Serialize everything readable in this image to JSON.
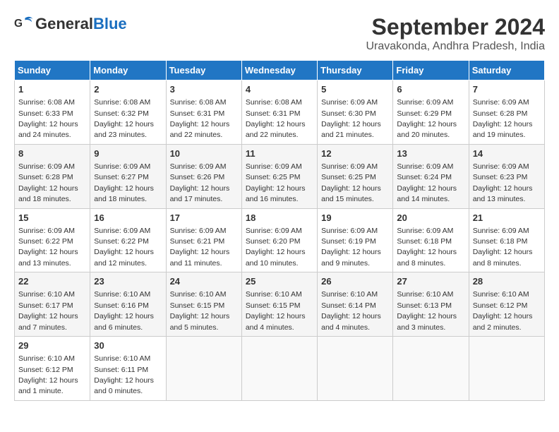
{
  "header": {
    "logo_general": "General",
    "logo_blue": "Blue",
    "title": "September 2024",
    "subtitle": "Uravakonda, Andhra Pradesh, India"
  },
  "columns": [
    "Sunday",
    "Monday",
    "Tuesday",
    "Wednesday",
    "Thursday",
    "Friday",
    "Saturday"
  ],
  "weeks": [
    [
      {
        "day": "1",
        "sunrise": "Sunrise: 6:08 AM",
        "sunset": "Sunset: 6:33 PM",
        "daylight": "Daylight: 12 hours and 24 minutes."
      },
      {
        "day": "2",
        "sunrise": "Sunrise: 6:08 AM",
        "sunset": "Sunset: 6:32 PM",
        "daylight": "Daylight: 12 hours and 23 minutes."
      },
      {
        "day": "3",
        "sunrise": "Sunrise: 6:08 AM",
        "sunset": "Sunset: 6:31 PM",
        "daylight": "Daylight: 12 hours and 22 minutes."
      },
      {
        "day": "4",
        "sunrise": "Sunrise: 6:08 AM",
        "sunset": "Sunset: 6:31 PM",
        "daylight": "Daylight: 12 hours and 22 minutes."
      },
      {
        "day": "5",
        "sunrise": "Sunrise: 6:09 AM",
        "sunset": "Sunset: 6:30 PM",
        "daylight": "Daylight: 12 hours and 21 minutes."
      },
      {
        "day": "6",
        "sunrise": "Sunrise: 6:09 AM",
        "sunset": "Sunset: 6:29 PM",
        "daylight": "Daylight: 12 hours and 20 minutes."
      },
      {
        "day": "7",
        "sunrise": "Sunrise: 6:09 AM",
        "sunset": "Sunset: 6:28 PM",
        "daylight": "Daylight: 12 hours and 19 minutes."
      }
    ],
    [
      {
        "day": "8",
        "sunrise": "Sunrise: 6:09 AM",
        "sunset": "Sunset: 6:28 PM",
        "daylight": "Daylight: 12 hours and 18 minutes."
      },
      {
        "day": "9",
        "sunrise": "Sunrise: 6:09 AM",
        "sunset": "Sunset: 6:27 PM",
        "daylight": "Daylight: 12 hours and 18 minutes."
      },
      {
        "day": "10",
        "sunrise": "Sunrise: 6:09 AM",
        "sunset": "Sunset: 6:26 PM",
        "daylight": "Daylight: 12 hours and 17 minutes."
      },
      {
        "day": "11",
        "sunrise": "Sunrise: 6:09 AM",
        "sunset": "Sunset: 6:25 PM",
        "daylight": "Daylight: 12 hours and 16 minutes."
      },
      {
        "day": "12",
        "sunrise": "Sunrise: 6:09 AM",
        "sunset": "Sunset: 6:25 PM",
        "daylight": "Daylight: 12 hours and 15 minutes."
      },
      {
        "day": "13",
        "sunrise": "Sunrise: 6:09 AM",
        "sunset": "Sunset: 6:24 PM",
        "daylight": "Daylight: 12 hours and 14 minutes."
      },
      {
        "day": "14",
        "sunrise": "Sunrise: 6:09 AM",
        "sunset": "Sunset: 6:23 PM",
        "daylight": "Daylight: 12 hours and 13 minutes."
      }
    ],
    [
      {
        "day": "15",
        "sunrise": "Sunrise: 6:09 AM",
        "sunset": "Sunset: 6:22 PM",
        "daylight": "Daylight: 12 hours and 13 minutes."
      },
      {
        "day": "16",
        "sunrise": "Sunrise: 6:09 AM",
        "sunset": "Sunset: 6:22 PM",
        "daylight": "Daylight: 12 hours and 12 minutes."
      },
      {
        "day": "17",
        "sunrise": "Sunrise: 6:09 AM",
        "sunset": "Sunset: 6:21 PM",
        "daylight": "Daylight: 12 hours and 11 minutes."
      },
      {
        "day": "18",
        "sunrise": "Sunrise: 6:09 AM",
        "sunset": "Sunset: 6:20 PM",
        "daylight": "Daylight: 12 hours and 10 minutes."
      },
      {
        "day": "19",
        "sunrise": "Sunrise: 6:09 AM",
        "sunset": "Sunset: 6:19 PM",
        "daylight": "Daylight: 12 hours and 9 minutes."
      },
      {
        "day": "20",
        "sunrise": "Sunrise: 6:09 AM",
        "sunset": "Sunset: 6:18 PM",
        "daylight": "Daylight: 12 hours and 8 minutes."
      },
      {
        "day": "21",
        "sunrise": "Sunrise: 6:09 AM",
        "sunset": "Sunset: 6:18 PM",
        "daylight": "Daylight: 12 hours and 8 minutes."
      }
    ],
    [
      {
        "day": "22",
        "sunrise": "Sunrise: 6:10 AM",
        "sunset": "Sunset: 6:17 PM",
        "daylight": "Daylight: 12 hours and 7 minutes."
      },
      {
        "day": "23",
        "sunrise": "Sunrise: 6:10 AM",
        "sunset": "Sunset: 6:16 PM",
        "daylight": "Daylight: 12 hours and 6 minutes."
      },
      {
        "day": "24",
        "sunrise": "Sunrise: 6:10 AM",
        "sunset": "Sunset: 6:15 PM",
        "daylight": "Daylight: 12 hours and 5 minutes."
      },
      {
        "day": "25",
        "sunrise": "Sunrise: 6:10 AM",
        "sunset": "Sunset: 6:15 PM",
        "daylight": "Daylight: 12 hours and 4 minutes."
      },
      {
        "day": "26",
        "sunrise": "Sunrise: 6:10 AM",
        "sunset": "Sunset: 6:14 PM",
        "daylight": "Daylight: 12 hours and 4 minutes."
      },
      {
        "day": "27",
        "sunrise": "Sunrise: 6:10 AM",
        "sunset": "Sunset: 6:13 PM",
        "daylight": "Daylight: 12 hours and 3 minutes."
      },
      {
        "day": "28",
        "sunrise": "Sunrise: 6:10 AM",
        "sunset": "Sunset: 6:12 PM",
        "daylight": "Daylight: 12 hours and 2 minutes."
      }
    ],
    [
      {
        "day": "29",
        "sunrise": "Sunrise: 6:10 AM",
        "sunset": "Sunset: 6:12 PM",
        "daylight": "Daylight: 12 hours and 1 minute."
      },
      {
        "day": "30",
        "sunrise": "Sunrise: 6:10 AM",
        "sunset": "Sunset: 6:11 PM",
        "daylight": "Daylight: 12 hours and 0 minutes."
      },
      {
        "day": "",
        "sunrise": "",
        "sunset": "",
        "daylight": ""
      },
      {
        "day": "",
        "sunrise": "",
        "sunset": "",
        "daylight": ""
      },
      {
        "day": "",
        "sunrise": "",
        "sunset": "",
        "daylight": ""
      },
      {
        "day": "",
        "sunrise": "",
        "sunset": "",
        "daylight": ""
      },
      {
        "day": "",
        "sunrise": "",
        "sunset": "",
        "daylight": ""
      }
    ]
  ]
}
